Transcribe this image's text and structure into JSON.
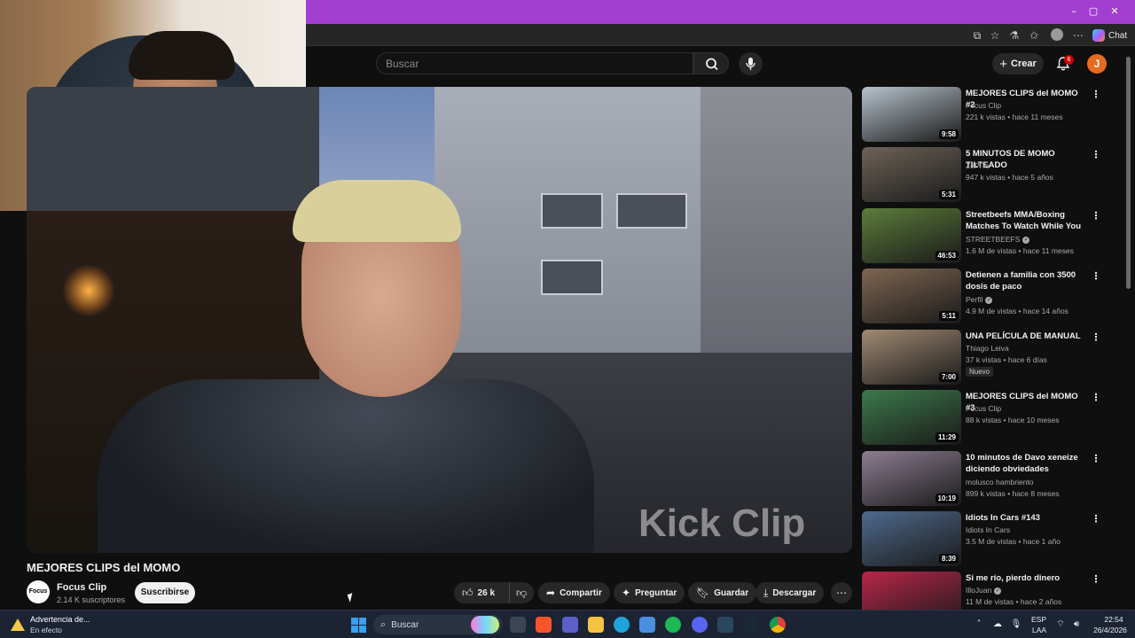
{
  "browser": {
    "chat_label": "Chat",
    "controls": {
      "minimize": "–",
      "maximize": "▢",
      "close": "✕"
    }
  },
  "header": {
    "search_placeholder": "Buscar",
    "create_label": "Crear",
    "notifications_count": "6",
    "avatar_letter": "J"
  },
  "player": {
    "watermark": "Kick Clip"
  },
  "video": {
    "title": "MEJORES CLIPS del MOMO",
    "channel_name": "Focus Clip",
    "channel_logo_text": "Focus clip",
    "subscribers": "2.14 K suscriptores",
    "subscribe_label": "Suscribirse",
    "likes": "26 k",
    "share_label": "Compartir",
    "ask_label": "Preguntar",
    "save_label": "Guardar",
    "download_label": "Descargar"
  },
  "recommendations": [
    {
      "title": "MEJORES CLIPS del MOMO #2",
      "channel": "Focus Clip",
      "verified": false,
      "views": "221 k vistas",
      "age": "hace 11 meses",
      "duration": "9:58",
      "thumb_color": "#b7c3cc"
    },
    {
      "title": "5 MINUTOS DE MOMO TILTEADO",
      "channel": "ZoPiTa",
      "verified": false,
      "views": "947 k vistas",
      "age": "hace 5 años",
      "duration": "5:31",
      "thumb_color": "#6d6358"
    },
    {
      "title": "Streetbeefs MMA/Boxing Matches To Watch While You ...",
      "channel": "STREETBEEFS",
      "verified": true,
      "views": "1.6 M de vistas",
      "age": "hace 11 meses",
      "duration": "46:53",
      "thumb_color": "#5c7d3a"
    },
    {
      "title": "Detienen a familia con 3500 dosis de paco",
      "channel": "Perfil",
      "verified": true,
      "views": "4.9 M de vistas",
      "age": "hace 14 años",
      "duration": "5:11",
      "thumb_color": "#7f6650"
    },
    {
      "title": "UNA PELÍCULA DE MANUAL",
      "channel": "Thiago Leiva",
      "verified": false,
      "views": "37 k vistas",
      "age": "hace 6 días",
      "duration": "7:00",
      "thumb_color": "#a08a72",
      "badge": "Nuevo"
    },
    {
      "title": "MEJORES CLIPS del MOMO #3",
      "channel": "Focus Clip",
      "verified": false,
      "views": "88 k vistas",
      "age": "hace 10 meses",
      "duration": "11:29",
      "thumb_color": "#3c7a4a"
    },
    {
      "title": "10 minutos de Davo xeneize diciendo obviedades",
      "channel": "molusco hambriento",
      "verified": false,
      "views": "899 k vistas",
      "age": "hace 8 meses",
      "duration": "10:19",
      "thumb_color": "#8d7e92"
    },
    {
      "title": "Idiots In Cars #143",
      "channel": "Idiots In Cars",
      "verified": false,
      "views": "3.5 M de vistas",
      "age": "hace 1 año",
      "duration": "8:39",
      "thumb_color": "#4e6a8c"
    },
    {
      "title": "Si me río, pierdo dinero",
      "channel": "IlloJuan",
      "verified": true,
      "views": "11 M de vistas",
      "age": "hace 2 años",
      "duration": "",
      "thumb_color": "#b8264a"
    }
  ],
  "taskbar": {
    "notice_title": "Advertencia de...",
    "notice_status": "En efecto",
    "search_placeholder": "Buscar",
    "language_top": "ESP",
    "language_bottom": "LAA",
    "time": "22:54",
    "date": "26/4/2026"
  }
}
